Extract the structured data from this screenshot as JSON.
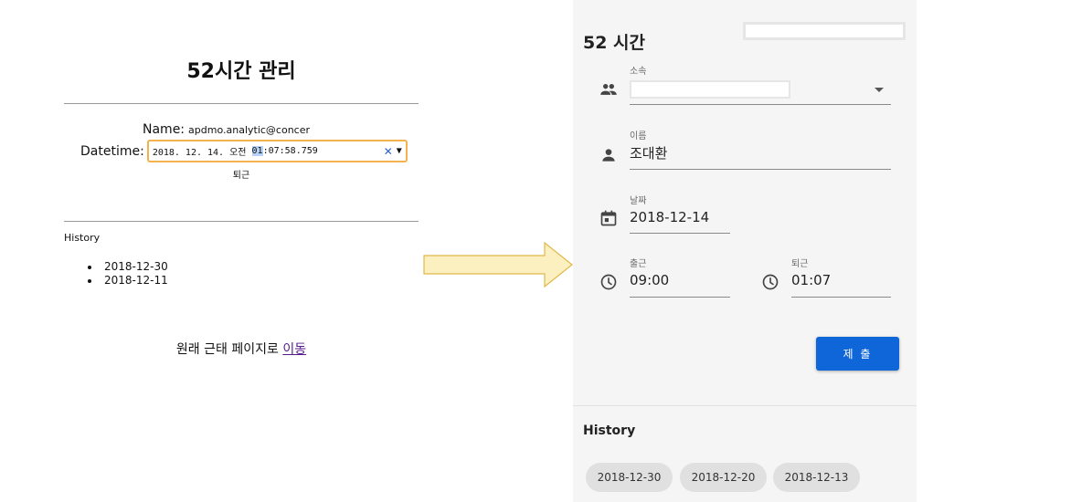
{
  "old_page": {
    "title": "52시간 관리",
    "name_label": "Name:",
    "name_value": "apdmo.analytic@concer",
    "datetime_label": "Datetime:",
    "datetime_value_before": "2018. 12. 14. 오전 ",
    "datetime_value_selected": "01",
    "datetime_value_after": ":07:58.759",
    "clear_symbol": "✕",
    "dropdown_symbol": "▼",
    "leave_label": "퇴근",
    "history_title": "History",
    "history_items": [
      "2018-12-30",
      "2018-12-11"
    ],
    "move_text": "원래 근태 페이지로 ",
    "move_link": "이동"
  },
  "new_page": {
    "title": "52 시간",
    "group_field": {
      "label": "소속",
      "value": "",
      "icon": "people-icon"
    },
    "name_field": {
      "label": "이름",
      "value": "조대환",
      "icon": "person-icon"
    },
    "date_field": {
      "label": "날짜",
      "value": "2018-12-14",
      "icon": "calendar-icon"
    },
    "start_field": {
      "label": "출근",
      "value": "09:00",
      "icon": "clock-icon"
    },
    "end_field": {
      "label": "퇴근",
      "value": "01:07",
      "icon": "clock-icon"
    },
    "submit_label": "제 출",
    "history_title": "History",
    "history_chips": [
      "2018-12-30",
      "2018-12-20",
      "2018-12-13"
    ]
  },
  "colors": {
    "accent": "#0f66d9",
    "input_focus": "#f4b24e",
    "arrow_fill": "#fdf0c0",
    "arrow_stroke": "#e0b84a",
    "link": "#551a8b"
  }
}
